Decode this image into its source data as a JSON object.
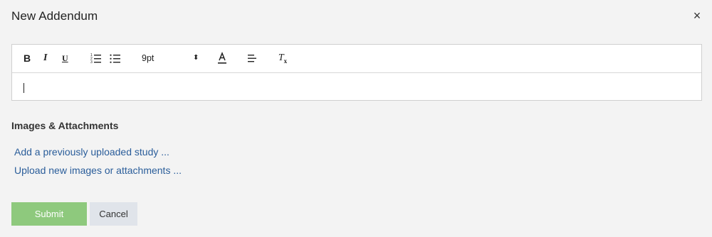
{
  "dialog": {
    "title": "New Addendum",
    "close_label": "×"
  },
  "toolbar": {
    "bold_label": "B",
    "italic_label": "I",
    "underline_label": "U",
    "ordered_list_icon": "ordered-list-icon",
    "bullet_list_icon": "bullet-list-icon",
    "font_size_value": "9pt",
    "font_size_caret": "⬍",
    "text_color_icon": "text-color-icon",
    "align_icon": "align-left-icon",
    "clear_format_label": "T",
    "clear_format_sub": "x"
  },
  "editor": {
    "value": ""
  },
  "attachments": {
    "section_title": "Images & Attachments",
    "link_previous": "Add a previously uploaded study ...",
    "link_upload": "Upload new images or attachments ..."
  },
  "actions": {
    "submit_label": "Submit",
    "cancel_label": "Cancel"
  },
  "colors": {
    "submit_bg": "#8ec97d",
    "cancel_bg": "#e0e4ea",
    "link": "#2a5d9a",
    "background": "#f3f3f3"
  }
}
